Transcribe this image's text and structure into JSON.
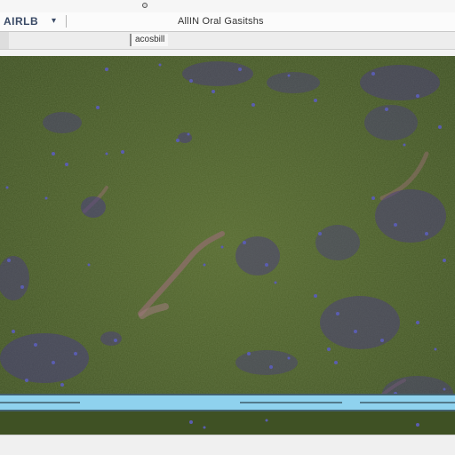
{
  "window": {
    "app_menu_label": "AIRLB",
    "app_menu_arrow": "▾",
    "title": "AllIN Oral Gasitshs"
  },
  "toolbar": {
    "field_text": "acosbill"
  },
  "map": {
    "grass_color": "#4a5c2a",
    "flower_color": "#4a3c7a",
    "path_color": "#8a6a68",
    "water_color": "#8fd2ee"
  }
}
